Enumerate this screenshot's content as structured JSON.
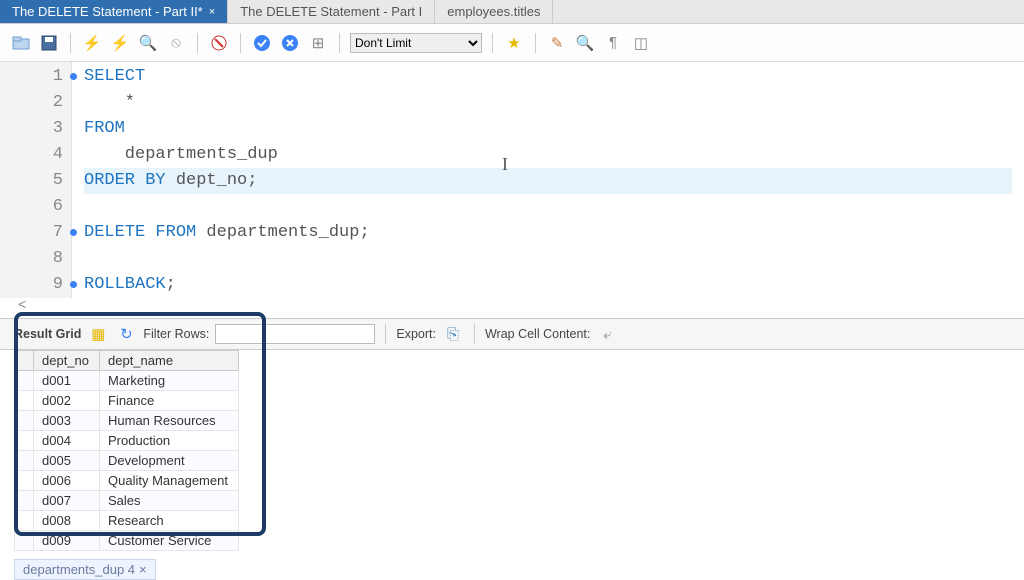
{
  "tabs": [
    {
      "label": "The DELETE Statement - Part II*",
      "active": true,
      "closable": true
    },
    {
      "label": "The DELETE Statement - Part I",
      "active": false,
      "closable": false
    },
    {
      "label": "employees.titles",
      "active": false,
      "closable": false
    }
  ],
  "toolbar": {
    "limit_label": "Don't Limit"
  },
  "editor": {
    "lines": [
      {
        "n": "1",
        "dot": true,
        "hl": false,
        "tokens": [
          [
            "kw",
            "SELECT"
          ]
        ]
      },
      {
        "n": "2",
        "dot": false,
        "hl": false,
        "tokens": [
          [
            "ident",
            "    *"
          ]
        ]
      },
      {
        "n": "3",
        "dot": false,
        "hl": false,
        "tokens": [
          [
            "kw",
            "FROM"
          ]
        ]
      },
      {
        "n": "4",
        "dot": false,
        "hl": false,
        "tokens": [
          [
            "ident",
            "    departments_dup"
          ]
        ]
      },
      {
        "n": "5",
        "dot": false,
        "hl": true,
        "tokens": [
          [
            "kw",
            "ORDER BY"
          ],
          [
            "ident",
            " dept_no;"
          ]
        ]
      },
      {
        "n": "6",
        "dot": false,
        "hl": false,
        "tokens": []
      },
      {
        "n": "7",
        "dot": true,
        "hl": false,
        "tokens": [
          [
            "kw",
            "DELETE FROM"
          ],
          [
            "ident",
            " departments_dup;"
          ]
        ]
      },
      {
        "n": "8",
        "dot": false,
        "hl": false,
        "tokens": []
      },
      {
        "n": "9",
        "dot": true,
        "hl": false,
        "tokens": [
          [
            "kw",
            "ROLLBACK"
          ],
          [
            "ident",
            ";"
          ]
        ]
      }
    ],
    "scroll_hint": "<"
  },
  "result_bar": {
    "result_grid": "Result Grid",
    "filter_label": "Filter Rows:",
    "export_label": "Export:",
    "wrap_label": "Wrap Cell Content:"
  },
  "result": {
    "columns": [
      "dept_no",
      "dept_name"
    ],
    "rows": [
      [
        "d001",
        "Marketing"
      ],
      [
        "d002",
        "Finance"
      ],
      [
        "d003",
        "Human Resources"
      ],
      [
        "d004",
        "Production"
      ],
      [
        "d005",
        "Development"
      ],
      [
        "d006",
        "Quality Management"
      ],
      [
        "d007",
        "Sales"
      ],
      [
        "d008",
        "Research"
      ],
      [
        "d009",
        "Customer Service"
      ]
    ]
  },
  "bottom_tab": {
    "label": "departments_dup 4"
  }
}
